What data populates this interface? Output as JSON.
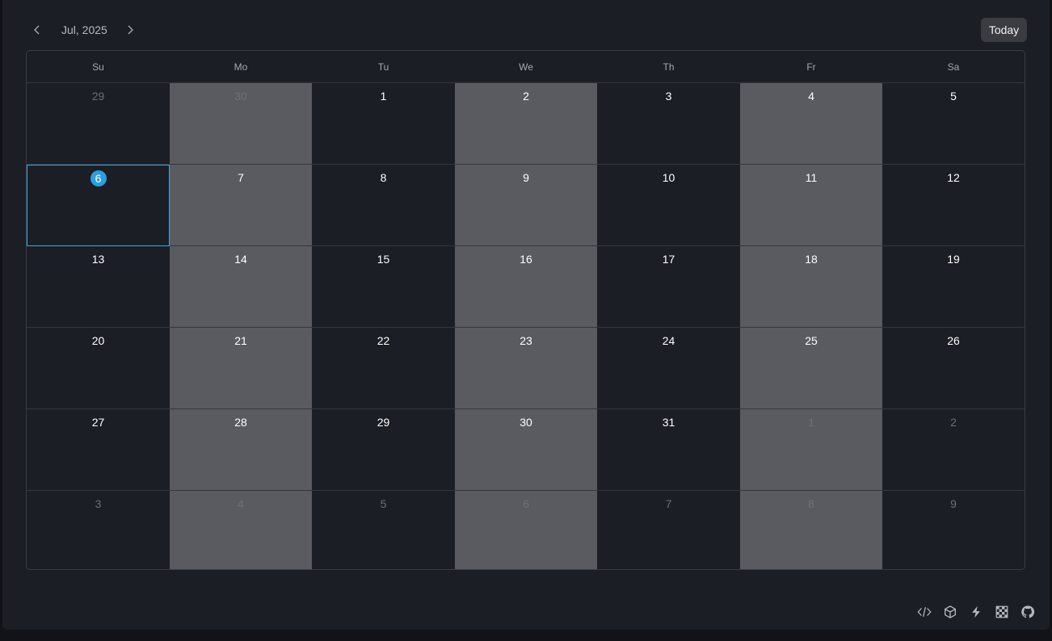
{
  "header": {
    "month_label": "Jul, 2025",
    "today_label": "Today",
    "prev_icon": "chevron-left-icon",
    "next_icon": "chevron-right-icon"
  },
  "weekdays": [
    "Su",
    "Mo",
    "Tu",
    "We",
    "Th",
    "Fr",
    "Sa"
  ],
  "weeks": [
    [
      {
        "d": "29",
        "o": true
      },
      {
        "d": "30",
        "o": true
      },
      {
        "d": "1"
      },
      {
        "d": "2"
      },
      {
        "d": "3"
      },
      {
        "d": "4"
      },
      {
        "d": "5"
      }
    ],
    [
      {
        "d": "6",
        "t": true
      },
      {
        "d": "7"
      },
      {
        "d": "8"
      },
      {
        "d": "9"
      },
      {
        "d": "10"
      },
      {
        "d": "11"
      },
      {
        "d": "12"
      }
    ],
    [
      {
        "d": "13"
      },
      {
        "d": "14"
      },
      {
        "d": "15"
      },
      {
        "d": "16"
      },
      {
        "d": "17"
      },
      {
        "d": "18"
      },
      {
        "d": "19"
      }
    ],
    [
      {
        "d": "20"
      },
      {
        "d": "21"
      },
      {
        "d": "22"
      },
      {
        "d": "23"
      },
      {
        "d": "24"
      },
      {
        "d": "25"
      },
      {
        "d": "26"
      }
    ],
    [
      {
        "d": "27"
      },
      {
        "d": "28"
      },
      {
        "d": "29"
      },
      {
        "d": "30"
      },
      {
        "d": "31"
      },
      {
        "d": "1",
        "o": true
      },
      {
        "d": "2",
        "o": true
      }
    ],
    [
      {
        "d": "3",
        "o": true
      },
      {
        "d": "4",
        "o": true
      },
      {
        "d": "5",
        "o": true
      },
      {
        "d": "6",
        "o": true
      },
      {
        "d": "7",
        "o": true
      },
      {
        "d": "8",
        "o": true
      },
      {
        "d": "9",
        "o": true
      }
    ]
  ],
  "footer_icons": [
    "code-icon",
    "cube-icon",
    "lightning-icon",
    "checkerboard-icon",
    "github-icon"
  ],
  "colors": {
    "accent": "#2d9ee0",
    "today_border": "#3ea6e0",
    "shaded_column": "#5a5b60",
    "background": "#1b1e24"
  }
}
